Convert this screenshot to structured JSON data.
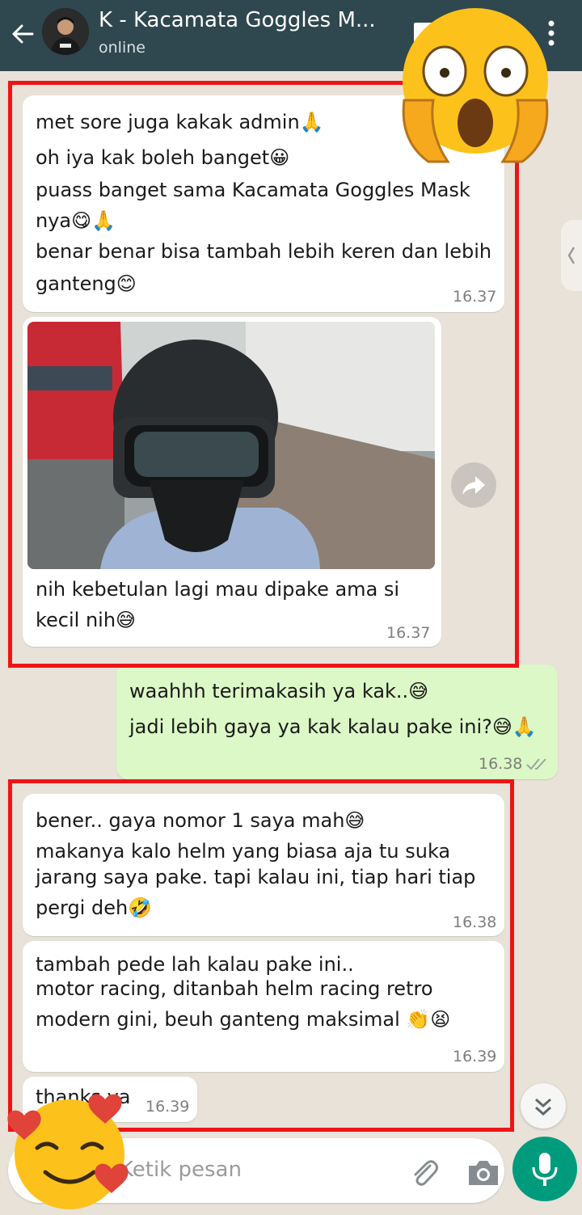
{
  "header": {
    "title": "K - Kacamata Goggles M...",
    "status": "online"
  },
  "messages": [
    {
      "direction": "in",
      "lines": [
        "met sore juga kakak admin🙏",
        "oh iya kak boleh banget😀",
        "puass banget sama Kacamata Goggles Mask",
        "nya😋🙏",
        "benar benar bisa tambah lebih keren dan lebih",
        "ganteng😊"
      ],
      "time": "16.37"
    },
    {
      "direction": "in",
      "has_image": true,
      "lines": [
        "nih kebetulan lagi mau dipake ama si",
        "kecil nih😅"
      ],
      "time": "16.37"
    },
    {
      "direction": "out",
      "lines": [
        "waahhh terimakasih ya kak..😅",
        "jadi lebih gaya ya kak kalau pake ini?😅🙏"
      ],
      "time": "16.38",
      "receipt": "read"
    },
    {
      "direction": "in",
      "lines": [
        "bener.. gaya nomor 1 saya mah😅",
        "makanya kalo helm yang biasa aja tu suka",
        "jarang saya pake. tapi kalau ini, tiap hari tiap",
        "pergi deh🤣"
      ],
      "time": "16.38"
    },
    {
      "direction": "in",
      "lines": [
        "tambah pede lah kalau pake ini..",
        "motor racing, ditanbah helm racing retro",
        "modern gini, beuh ganteng maksimal 👏😫"
      ],
      "time": "16.39"
    },
    {
      "direction": "in",
      "lines": [
        "thanks ya"
      ],
      "time": "16.39"
    }
  ],
  "input": {
    "placeholder": "Ketik pesan"
  },
  "icons": {
    "back": "arrow-left-icon",
    "menu": "more-vertical-icon",
    "forward": "forward-icon",
    "scroll": "double-chevron-down-icon",
    "attach": "paperclip-icon",
    "camera": "camera-icon",
    "mic": "mic-icon"
  },
  "colors": {
    "header": "#2f474f",
    "chat_bg": "#e8e2d9",
    "incoming": "#ffffff",
    "outgoing": "#dcf8c6",
    "highlight": "#ee1515",
    "mic": "#009b7d"
  }
}
